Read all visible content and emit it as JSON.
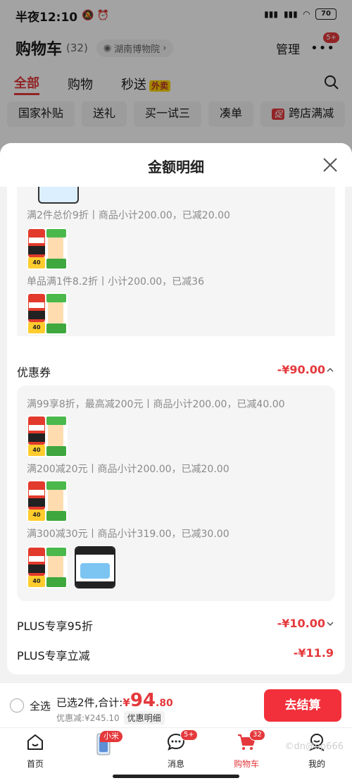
{
  "status_bar": {
    "time": "半夜12:10",
    "battery": "70"
  },
  "cart_header": {
    "title": "购物车",
    "count": "(32)",
    "location": "湖南博物院",
    "manage": "管理",
    "more_badge": "5+"
  },
  "cart_tabs": [
    {
      "label": "全部"
    },
    {
      "label": "购物"
    },
    {
      "label": "秒送",
      "tag": "外卖"
    }
  ],
  "filter_chips": [
    "国家补贴",
    "送礼",
    "买一试三",
    "凑单",
    "跨店满减"
  ],
  "filter_promo_tag": "促",
  "sheet": {
    "title": "金额明细",
    "promotions": [
      {
        "rule": "满2件总价9折丨商品小计200.00，已减20.00"
      },
      {
        "rule": "单品满1件8.2折丨小计200.00，已减36"
      }
    ],
    "coupon": {
      "label": "优惠券",
      "amount": "-¥90.00",
      "rules": [
        {
          "rule": "满99享8折，最高减200元丨商品小计200.00，已减40.00"
        },
        {
          "rule": "满200减20元丨商品小计200.00，已减20.00"
        },
        {
          "rule": "满300减30元丨商品小计319.00，已减30.00"
        }
      ]
    },
    "plus_discount": {
      "label": "PLUS专享95折",
      "amount": "-¥10.00"
    },
    "plus_instant": {
      "label": "PLUS专享立减",
      "amount": "-¥11.9"
    }
  },
  "checkout": {
    "select_all": "全选",
    "selected_prefix": "已选2件,合计:",
    "currency": "¥",
    "total_int": "94",
    "total_dec": ".80",
    "discount_text": "优惠减:¥245.10",
    "detail_chip": "优惠明细",
    "button": "去结算"
  },
  "thumb_label": "40",
  "tab_bar": [
    {
      "label": "首页"
    },
    {
      "label": "",
      "badge": "小米"
    },
    {
      "label": "消息",
      "badge": "5+"
    },
    {
      "label": "购物车",
      "badge": "32"
    },
    {
      "label": "我的"
    }
  ],
  "watermark": "©dn@op666",
  "colors": {
    "accent": "#e4393c",
    "checkout_button": "#f2303b"
  }
}
